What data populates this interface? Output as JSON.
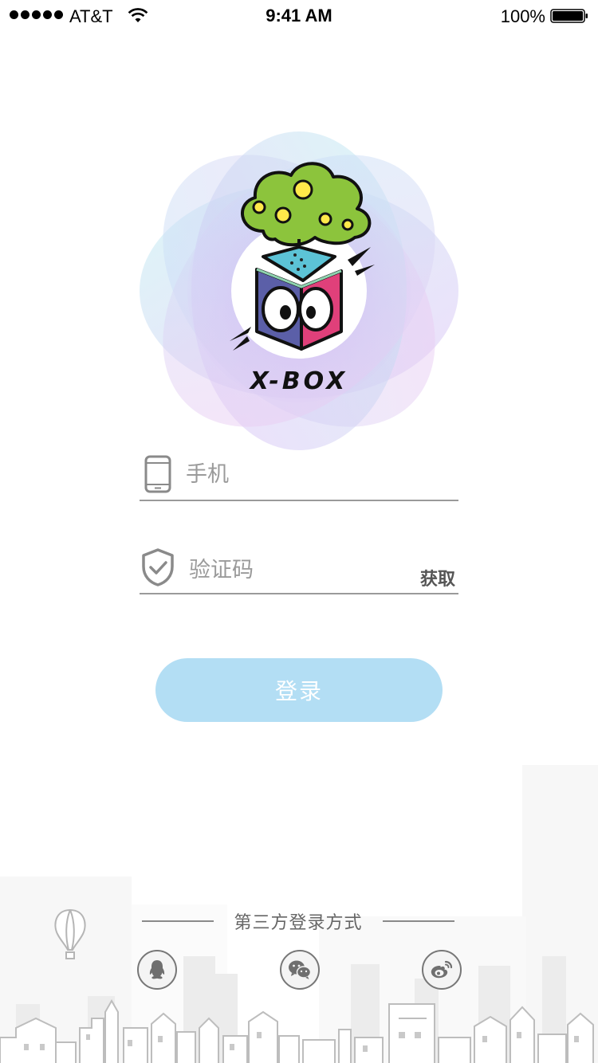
{
  "status_bar": {
    "carrier": "AT&T",
    "time": "9:41 AM",
    "battery": "100%"
  },
  "logo": {
    "text": "X-BOX"
  },
  "login_form": {
    "phone_placeholder": "手机",
    "code_placeholder": "验证码",
    "get_code_label": "获取",
    "login_label": "登录"
  },
  "third_party": {
    "title": "第三方登录方式",
    "providers": [
      {
        "name": "QQ",
        "icon": "qq-icon"
      },
      {
        "name": "WeChat",
        "icon": "wechat-icon"
      },
      {
        "name": "Weibo",
        "icon": "weibo-icon"
      }
    ]
  },
  "colors": {
    "login_button": "#b3def4",
    "underline": "#9a9a9a",
    "logo_tree": "#8cc43c",
    "logo_lid": "#5cc3d6",
    "logo_left_face": "#5b5fa8",
    "logo_right_face": "#e0407a"
  }
}
